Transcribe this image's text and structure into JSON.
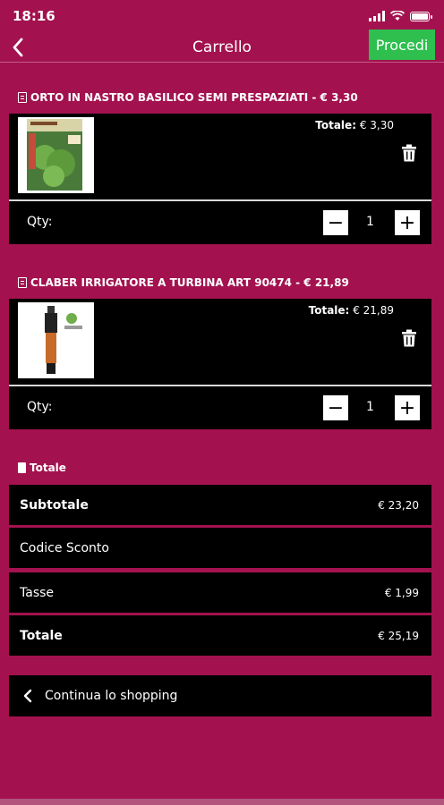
{
  "status": {
    "time": "18:16"
  },
  "header": {
    "title": "Carrello",
    "proceed_label": "Procedi"
  },
  "items": [
    {
      "heading": "ORTO IN NASTRO BASILICO SEMI PRESPAZIATI - € 3,30",
      "total_label": "Totale:",
      "total_value": "€ 3,30",
      "qty_label": "Qty:",
      "qty": "1",
      "image_icon": "seed-packet-image"
    },
    {
      "heading": "CLABER IRRIGATORE A TURBINA ART 90474 - € 21,89",
      "total_label": "Totale:",
      "total_value": "€ 21,89",
      "qty_label": "Qty:",
      "qty": "1",
      "image_icon": "sprinkler-image"
    }
  ],
  "summary": {
    "heading": "Totale",
    "rows": [
      {
        "label": "Subtotale",
        "value": "€ 23,20"
      },
      {
        "label": "Codice Sconto",
        "value": ""
      },
      {
        "label": "Tasse",
        "value": "€ 1,99"
      },
      {
        "label": "Totale",
        "value": "€ 25,19"
      }
    ]
  },
  "continue_label": "Continua lo shopping",
  "colors": {
    "background": "#a3124f",
    "card": "#000000",
    "proceed": "#2fbf4f"
  }
}
